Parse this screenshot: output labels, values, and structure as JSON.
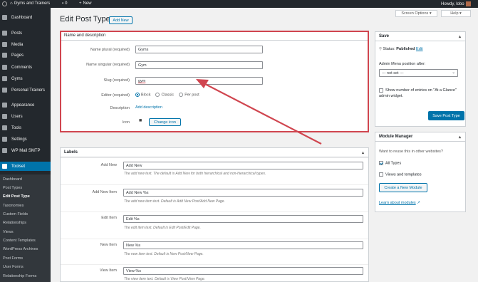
{
  "adminbar": {
    "site_name": "Gyms and Trainers",
    "comments_count": "0",
    "new_label": "New",
    "howdy": "Howdy, lobo"
  },
  "menu": {
    "items": [
      {
        "label": "Dashboard",
        "icon": "dashboard-icon"
      },
      {
        "label": "Posts",
        "icon": "pin-icon"
      },
      {
        "label": "Media",
        "icon": "media-icon"
      },
      {
        "label": "Pages",
        "icon": "page-icon"
      },
      {
        "label": "Comments",
        "icon": "comment-icon"
      },
      {
        "label": "Gyms",
        "icon": "gym-icon"
      },
      {
        "label": "Personal Trainers",
        "icon": "trainer-icon"
      },
      {
        "label": "Appearance",
        "icon": "brush-icon"
      },
      {
        "label": "Users",
        "icon": "users-icon"
      },
      {
        "label": "Tools",
        "icon": "wrench-icon"
      },
      {
        "label": "Settings",
        "icon": "settings-icon"
      },
      {
        "label": "WP Mail SMTP",
        "icon": "mail-icon"
      },
      {
        "label": "Toolset",
        "icon": "toolset-icon"
      }
    ],
    "submenu": [
      "Dashboard",
      "Post Types",
      "Edit Post Type",
      "Taxonomies",
      "Custom Fields",
      "Relationships",
      "Views",
      "Content Templates",
      "WordPress Archives",
      "Post Forms",
      "User Forms",
      "Relationship Forms"
    ]
  },
  "header": {
    "title": "Edit Post Type",
    "add_new": "Add New",
    "screen_options": "Screen Options ▾",
    "help": "Help ▾"
  },
  "name_box": {
    "title": "Name and description",
    "plural_label": "Name plural",
    "singular_label": "Name singular",
    "slug_label": "Slug",
    "required": "(required)",
    "plural_value": "Gyms",
    "singular_value": "Gym",
    "slug_value": "gym",
    "editor_label": "Editor",
    "editor_options": [
      "Block",
      "Classic",
      "Per post"
    ],
    "description_label": "Description",
    "add_description": "Add description",
    "icon_label": "Icon",
    "change_icon": "Change icon"
  },
  "labels_box": {
    "title": "Labels",
    "rows": [
      {
        "label": "Add New",
        "value": "Add New",
        "hint": "The add new text. The default is Add New for both hierarchical and non-hierarchical types."
      },
      {
        "label": "Add New Item",
        "value": "Add New %s",
        "hint": "The add new item text. Default is Add New Post/Add New Page."
      },
      {
        "label": "Edit Item",
        "value": "Edit %s",
        "hint": "The edit item text. Default is Edit Post/Edit Page."
      },
      {
        "label": "New Item",
        "value": "New %s",
        "hint": "The new item text. Default is New Post/New Page."
      },
      {
        "label": "View Item",
        "value": "View %s",
        "hint": "The view item text. Default is View Post/View Page."
      }
    ]
  },
  "save_box": {
    "title": "Save",
    "status_label": "Status:",
    "status_value": "Published",
    "edit": "Edit",
    "menu_position_label": "Admin Menu position after:",
    "menu_position_value": "--- not set ---",
    "show_count": "Show number of entries on \"At a Glance\" admin widget.",
    "save_button": "Save Post Type"
  },
  "module_box": {
    "title": "Module Manager",
    "question": "Want to reuse this in other websites?",
    "all_types": "All Types",
    "views_templates": "Views and templates",
    "create_button": "Create a New Module",
    "learn_more": "Learn about modules"
  },
  "colors": {
    "accent": "#0073aa",
    "highlight": "#d0454f",
    "sidebar": "#23282d"
  }
}
